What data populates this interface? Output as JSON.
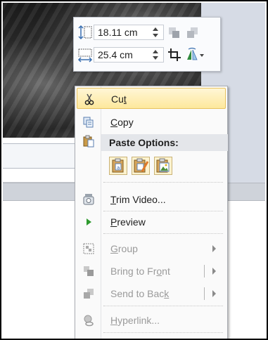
{
  "size_toolbar": {
    "height_value": "18.11 cm",
    "width_value": "25.4 cm",
    "icons": [
      "shape-height-icon",
      "bring-forward-icon",
      "send-backward-icon",
      "shape-width-icon",
      "crop-icon",
      "rotate-icon"
    ]
  },
  "context_menu": {
    "cut": {
      "pre": "Cu",
      "key": "t",
      "post": ""
    },
    "copy": {
      "pre": "",
      "key": "C",
      "post": "opy"
    },
    "paste_header": "Paste Options:",
    "trim_video": {
      "pre": "",
      "key": "T",
      "post": "rim Video..."
    },
    "preview": {
      "pre": "",
      "key": "P",
      "post": "review"
    },
    "group": {
      "pre": "",
      "key": "G",
      "post": "roup"
    },
    "bring_to_front": {
      "pre": "Bring to Fr",
      "key": "o",
      "post": "nt"
    },
    "send_to_back": {
      "pre": "Send to Bac",
      "key": "k",
      "post": ""
    },
    "hyperlink": {
      "pre": "",
      "key": "H",
      "post": "yperlink..."
    }
  },
  "colors": {
    "highlight_top": "#fff6d6",
    "highlight_bottom": "#fde89c",
    "menu_bg": "#fafafa",
    "disabled_text": "#9a9a9a"
  }
}
